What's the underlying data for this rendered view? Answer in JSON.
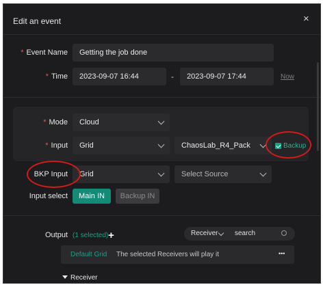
{
  "dialog": {
    "title": "Edit an event",
    "close_icon": "×"
  },
  "event_name": {
    "label": "Event Name",
    "value": "Getting the job done"
  },
  "time": {
    "label": "Time",
    "start": "2023-09-07 16:44",
    "separator": "-",
    "end": "2023-09-07 17:44",
    "now_link": "Now"
  },
  "mode": {
    "label": "Mode",
    "value": "Cloud"
  },
  "input": {
    "label": "Input",
    "value": "Grid",
    "source": "ChaosLab_R4_Pack",
    "backup_label": "Backup",
    "backup_checked": true
  },
  "bkp_input": {
    "label": "BKP Input",
    "value": "Grid",
    "source_placeholder": "Select Source"
  },
  "input_select": {
    "label": "Input select",
    "main_btn": "Main IN",
    "backup_btn": "Backup IN"
  },
  "output": {
    "label": "Output",
    "selected_count": "(1 selected)",
    "add_icon": "+",
    "receiver_filter": "Receiver",
    "search_placeholder": "search"
  },
  "output_row": {
    "name": "Default Grid",
    "description": "The selected Receivers will play it",
    "more_icon": "•••"
  },
  "receiver_section": {
    "label": "Receiver"
  },
  "colors": {
    "accent": "#138b76",
    "required": "#e0585c",
    "annotation": "#d51a1a",
    "background": "#1c1c1e"
  }
}
